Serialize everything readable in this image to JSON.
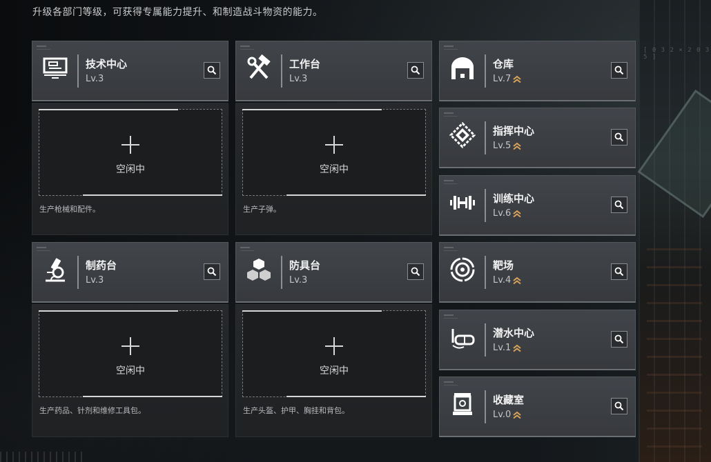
{
  "header": {
    "subtitle": "升级各部门等级，可获得专属能力提升、和制造战斗物资的能力。"
  },
  "decor": {
    "tech_text": "[ 0 3 2 × 2 0 3 5 ]"
  },
  "production": [
    {
      "name": "技术中心",
      "level": "Lv.3",
      "icon": "monitor-icon",
      "slot_label": "空闲中",
      "description": "生产枪械和配件。"
    },
    {
      "name": "工作台",
      "level": "Lv.3",
      "icon": "hammer-wrench-icon",
      "slot_label": "空闲中",
      "description": "生产子弹。"
    },
    {
      "name": "制药台",
      "level": "Lv.3",
      "icon": "microscope-icon",
      "slot_label": "空闲中",
      "description": "生产药品、针剂和维修工具包。"
    },
    {
      "name": "防具台",
      "level": "Lv.3",
      "icon": "cubes-icon",
      "slot_label": "空闲中",
      "description": "生产头盔、护甲、胸挂和背包。"
    }
  ],
  "facilities": [
    {
      "name": "仓库",
      "level": "Lv.7",
      "icon": "warehouse-icon",
      "upgradable": true
    },
    {
      "name": "指挥中心",
      "level": "Lv.5",
      "icon": "chip-icon",
      "upgradable": true
    },
    {
      "name": "训练中心",
      "level": "Lv.6",
      "icon": "dumbbell-icon",
      "upgradable": true
    },
    {
      "name": "靶场",
      "level": "Lv.4",
      "icon": "target-icon",
      "upgradable": true
    },
    {
      "name": "潜水中心",
      "level": "Lv.1",
      "icon": "dive-mask-icon",
      "upgradable": true
    },
    {
      "name": "收藏室",
      "level": "Lv.0",
      "icon": "display-case-icon",
      "upgradable": true
    }
  ],
  "colors": {
    "upgrade_arrow": "#d9a45a",
    "card_bg": "#3d4044",
    "panel_bg": "#222426"
  }
}
